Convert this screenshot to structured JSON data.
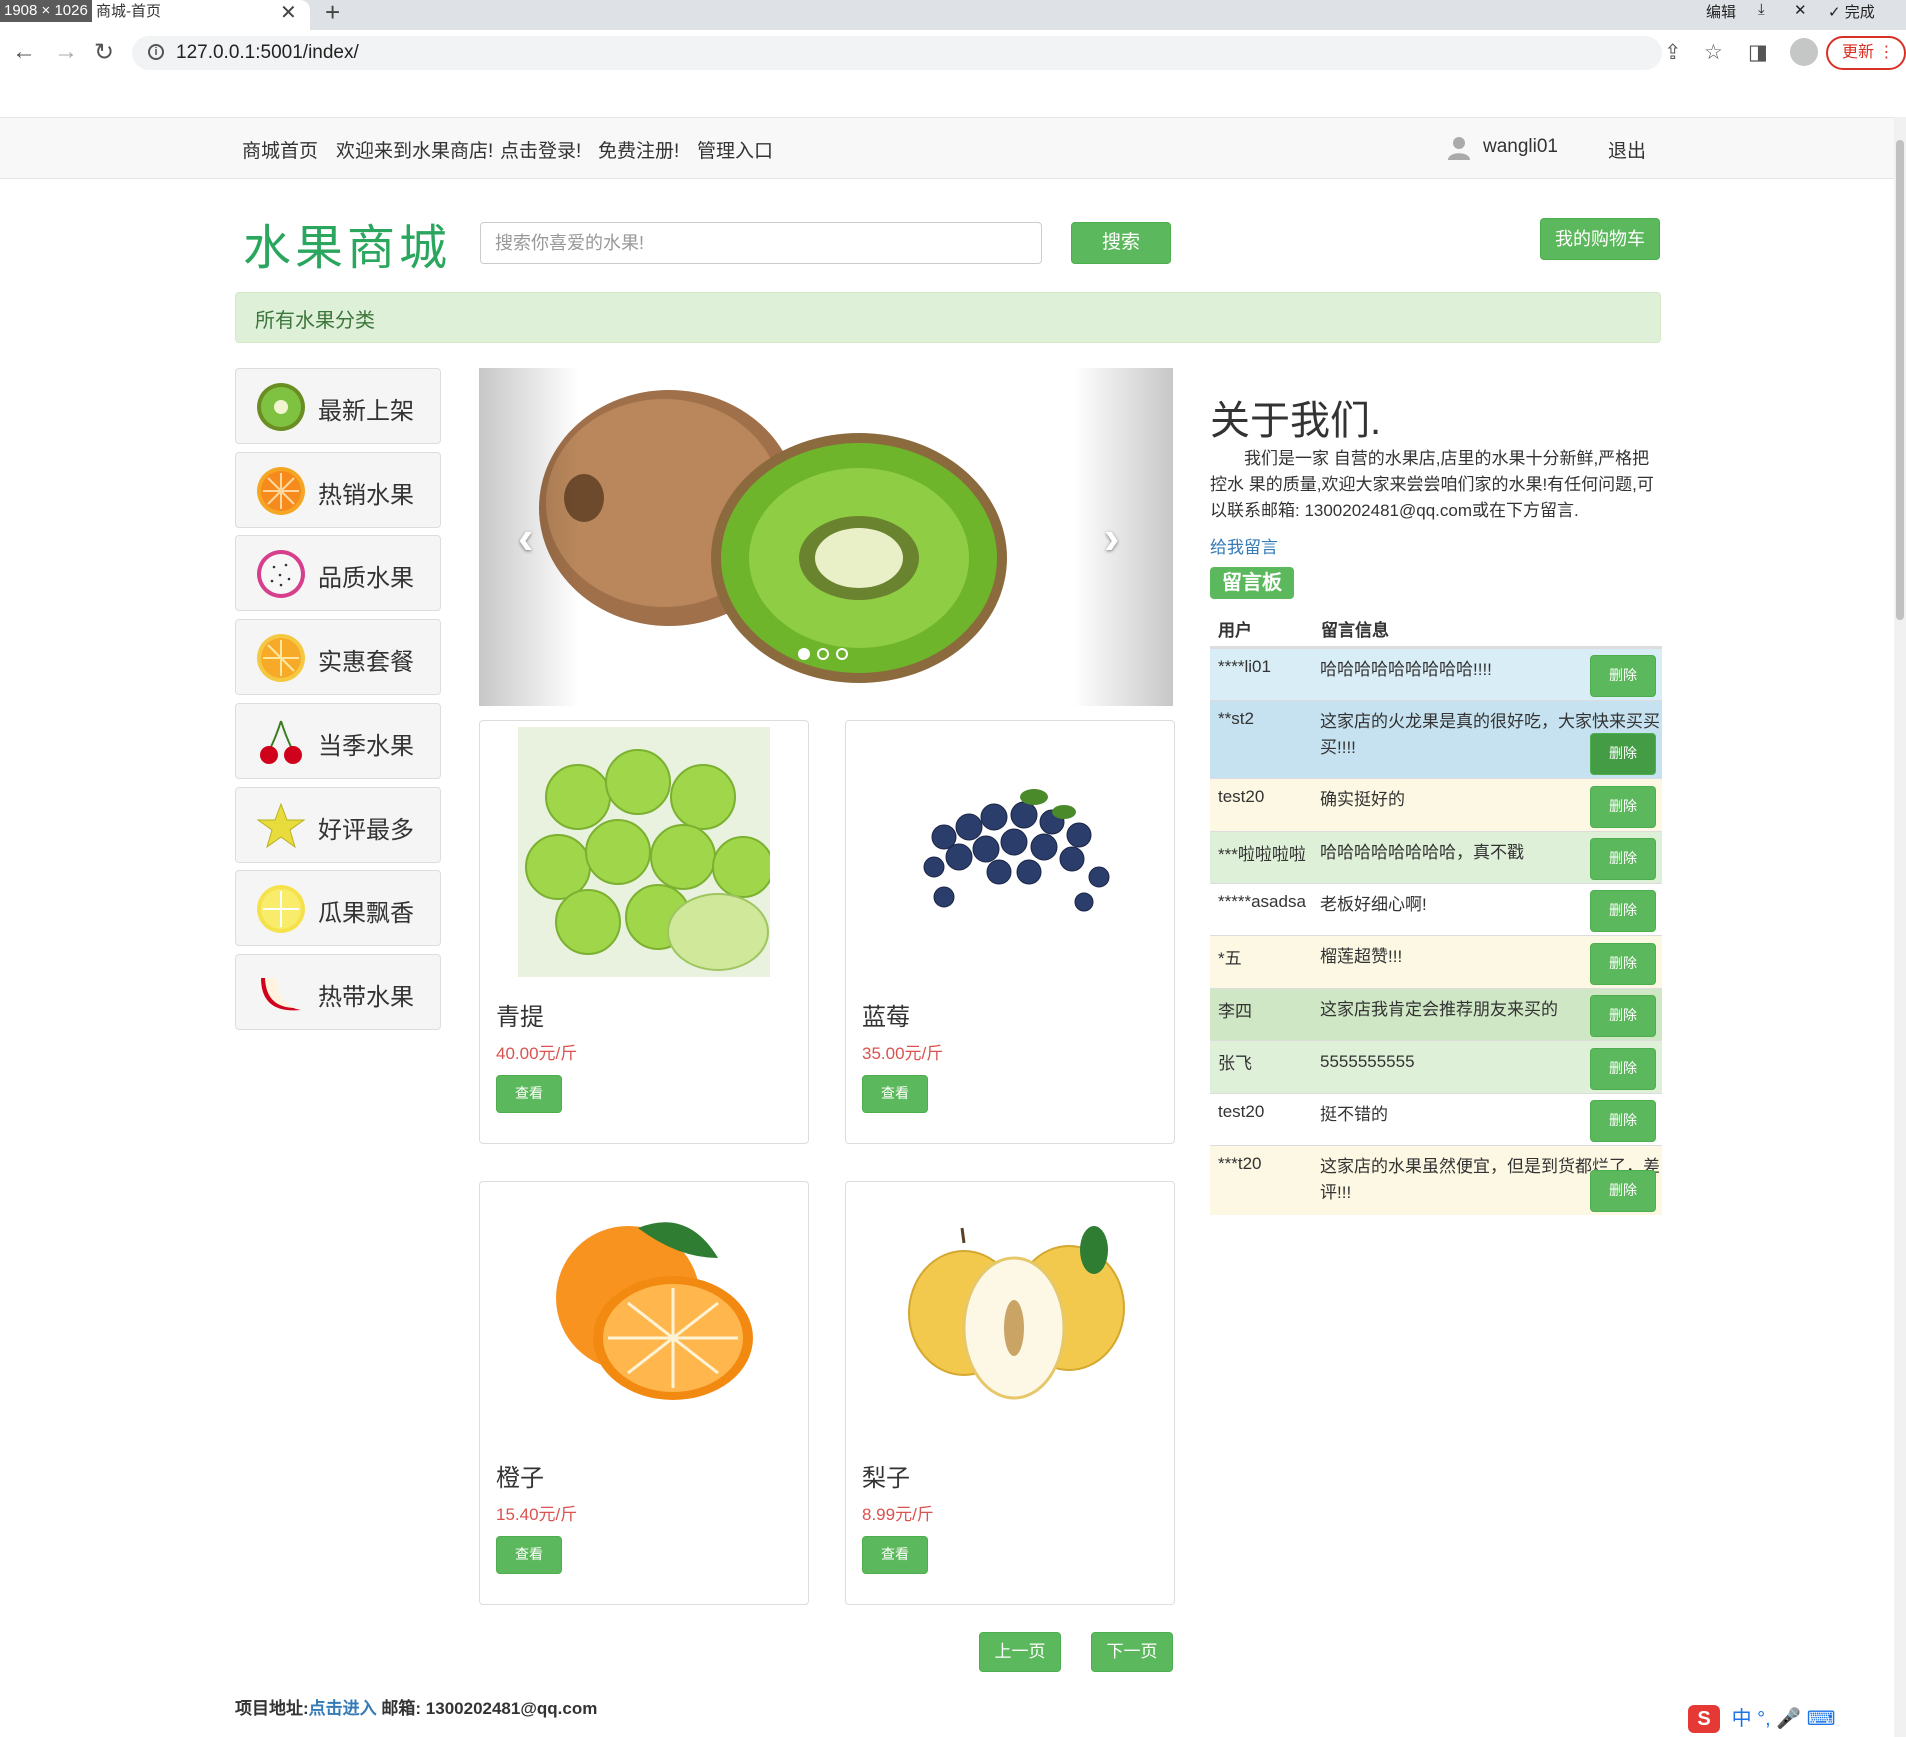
{
  "browser": {
    "dimension_badge": "1908 × 1026",
    "tab_title": "商城-首页",
    "url": "127.0.0.1:5001/index/",
    "toolbar_right": {
      "edit": "编辑",
      "done": "完成"
    },
    "update_label": "更新"
  },
  "navbar": {
    "links": [
      "商城首页",
      "欢迎来到水果商店!",
      "点击登录!",
      "免费注册!",
      "管理入口"
    ],
    "username": "wangli01",
    "logout": "退出"
  },
  "header": {
    "logo": "水果商城",
    "search_placeholder": "搜索你喜爱的水果!",
    "search_button": "搜索",
    "cart_button": "我的购物车"
  },
  "category_bar": "所有水果分类",
  "sidebar": [
    {
      "label": "最新上架",
      "icon": "kiwi-icon"
    },
    {
      "label": "热销水果",
      "icon": "orange-icon"
    },
    {
      "label": "品质水果",
      "icon": "dragonfruit-icon"
    },
    {
      "label": "实惠套餐",
      "icon": "lemon-icon"
    },
    {
      "label": "当季水果",
      "icon": "cherry-icon"
    },
    {
      "label": "好评最多",
      "icon": "starfruit-icon"
    },
    {
      "label": "瓜果飘香",
      "icon": "lemon-slice-icon"
    },
    {
      "label": "热带水果",
      "icon": "apple-slice-icon"
    }
  ],
  "carousel": {
    "image": "kiwi-icon",
    "left_arrow": "‹",
    "right_arrow": "›",
    "slide_count": 3,
    "active_index": 0
  },
  "products": [
    {
      "name": "青提",
      "price": "40.00元/斤",
      "button": "查看",
      "icon": "green-grape-icon"
    },
    {
      "name": "蓝莓",
      "price": "35.00元/斤",
      "button": "查看",
      "icon": "blueberry-icon"
    },
    {
      "name": "橙子",
      "price": "15.40元/斤",
      "button": "查看",
      "icon": "orange-icon"
    },
    {
      "name": "梨子",
      "price": "8.99元/斤",
      "button": "查看",
      "icon": "pear-icon"
    }
  ],
  "pagination": {
    "prev": "上一页",
    "next": "下一页"
  },
  "about": {
    "title": "关于我们.",
    "text": "我们是一家 自营的水果店,店里的水果十分新鲜,严格把控水 果的质量,欢迎大家来尝尝咱们家的水果!有任何问题,可以联系邮箱: 1300202481@qq.com或在下方留言.",
    "leave_message": "给我留言",
    "board_label": "留言板"
  },
  "messages": {
    "headers": {
      "user": "用户",
      "message": "留言信息"
    },
    "delete_label": "删除",
    "rows": [
      {
        "user": "****li01",
        "text": "哈哈哈哈哈哈哈哈哈!!!!",
        "bg": "#d9edf7"
      },
      {
        "user": "**st2",
        "text": "这家店的火龙果是真的很好吃，大家快来买买买!!!!",
        "bg": "#c6e2f0"
      },
      {
        "user": "test20",
        "text": "确实挺好的",
        "bg": "#fcf8e3"
      },
      {
        "user": "***啦啦啦啦",
        "text": "哈哈哈哈哈哈哈哈，真不戳",
        "bg": "#dff0d8"
      },
      {
        "user": "*****asadsa",
        "text": "老板好细心啊!",
        "bg": "#ffffff"
      },
      {
        "user": "*五",
        "text": "榴莲超赞!!!",
        "bg": "#fcf8e3"
      },
      {
        "user": "李四",
        "text": "这家店我肯定会推荐朋友来买的",
        "bg": "#cfe7c5"
      },
      {
        "user": "张飞",
        "text": "5555555555",
        "bg": "#dff0d8"
      },
      {
        "user": "test20",
        "text": "挺不错的",
        "bg": "#ffffff"
      },
      {
        "user": "***t20",
        "text": "这家店的水果虽然便宜，但是到货都烂了，差评!!!",
        "bg": "#fcf8e3"
      }
    ]
  },
  "footer": {
    "project_label": "项目地址:",
    "project_link": "点击进入",
    "email_label": "邮箱: 1300202481@qq.com"
  },
  "ime": {
    "lang": "中"
  }
}
